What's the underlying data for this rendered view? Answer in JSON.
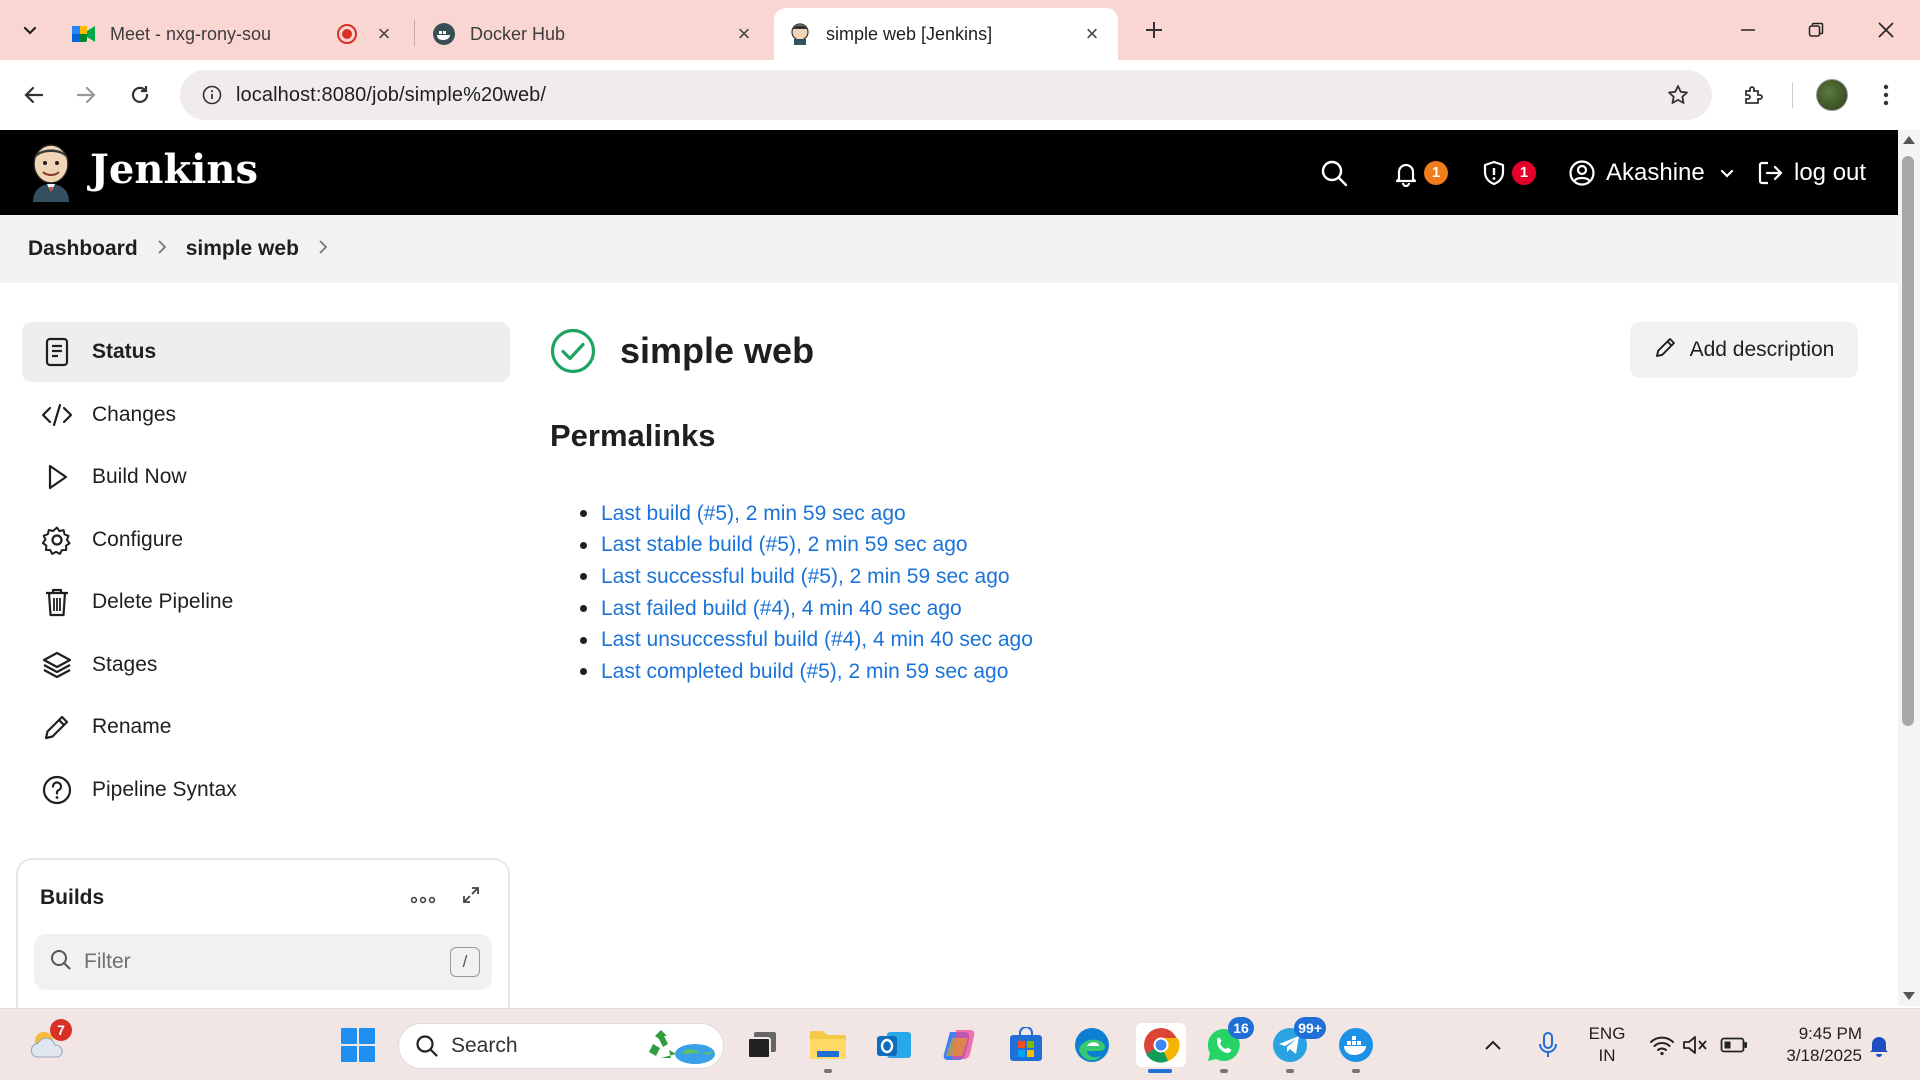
{
  "browser": {
    "tabs": [
      {
        "title": "Meet - nxg-rony-sou",
        "active": false
      },
      {
        "title": "Docker Hub",
        "active": false
      },
      {
        "title": "simple web [Jenkins]",
        "active": true
      }
    ],
    "url": "localhost:8080/job/simple%20web/"
  },
  "jenkins": {
    "brand": "Jenkins",
    "notifications_count": "1",
    "security_count": "1",
    "user": "Akashine",
    "logout_label": "log out",
    "colors": {
      "header_bg": "#000000",
      "notif_badge": "#f07c1b",
      "security_badge": "#e4002b",
      "link": "#1a73d9",
      "success": "#1ea362"
    }
  },
  "breadcrumb": [
    "Dashboard",
    "simple web"
  ],
  "sidebar": {
    "items": [
      {
        "label": "Status",
        "icon": "document-icon",
        "active": true
      },
      {
        "label": "Changes",
        "icon": "code-icon"
      },
      {
        "label": "Build Now",
        "icon": "play-icon"
      },
      {
        "label": "Configure",
        "icon": "gear-icon"
      },
      {
        "label": "Delete Pipeline",
        "icon": "trash-icon"
      },
      {
        "label": "Stages",
        "icon": "layers-icon"
      },
      {
        "label": "Rename",
        "icon": "pencil-icon"
      },
      {
        "label": "Pipeline Syntax",
        "icon": "help-icon"
      }
    ]
  },
  "builds": {
    "title": "Builds",
    "filter_placeholder": "Filter",
    "shortcut": "/"
  },
  "main": {
    "job_title": "simple web",
    "add_description": "Add description",
    "permalinks_heading": "Permalinks",
    "permalinks": [
      "Last build (#5), 2 min 59 sec ago",
      "Last stable build (#5), 2 min 59 sec ago",
      "Last successful build (#5), 2 min 59 sec ago",
      "Last failed build (#4), 4 min 40 sec ago",
      "Last unsuccessful build (#4), 4 min 40 sec ago",
      "Last completed build (#5), 2 min 59 sec ago"
    ]
  },
  "taskbar": {
    "weather_badge": "7",
    "search_label": "Search",
    "whatsapp_badge": "16",
    "telegram_badge": "99+",
    "lang_line1": "ENG",
    "lang_line2": "IN",
    "time": "9:45 PM",
    "date": "3/18/2025"
  }
}
